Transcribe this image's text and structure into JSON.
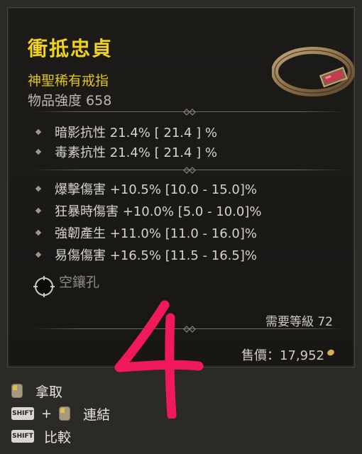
{
  "item": {
    "name": "衝抵忠貞",
    "type": "神聖稀有戒指",
    "power": "物品強度 658"
  },
  "affixes_group1": [
    {
      "text": "暗影抗性 21.4%   [ 21.4 ] %"
    },
    {
      "text": "毒素抗性 21.4%   [ 21.4 ] %"
    }
  ],
  "affixes_group2": [
    {
      "text": "爆擊傷害 +10.5% [10.0 - 15.0]%"
    },
    {
      "text": "狂暴時傷害 +10.0% [5.0 - 10.0]%"
    },
    {
      "text": "強韌產生 +11.0% [11.0 - 16.0]%"
    },
    {
      "text": "易傷傷害 +16.5% [11.5 - 16.5]%"
    }
  ],
  "socket": {
    "label": "空鑲孔"
  },
  "requirement": "需要等級 72",
  "price": "售價：17,952",
  "overlay_number": "4",
  "actions": [
    {
      "label": "拿取",
      "modifier": ""
    },
    {
      "label": "連結",
      "modifier": "SHIFT"
    },
    {
      "label": "比較",
      "modifier": "SHIFT"
    }
  ],
  "colors": {
    "title": "#f2d31b",
    "overlay": "#f0195a"
  }
}
